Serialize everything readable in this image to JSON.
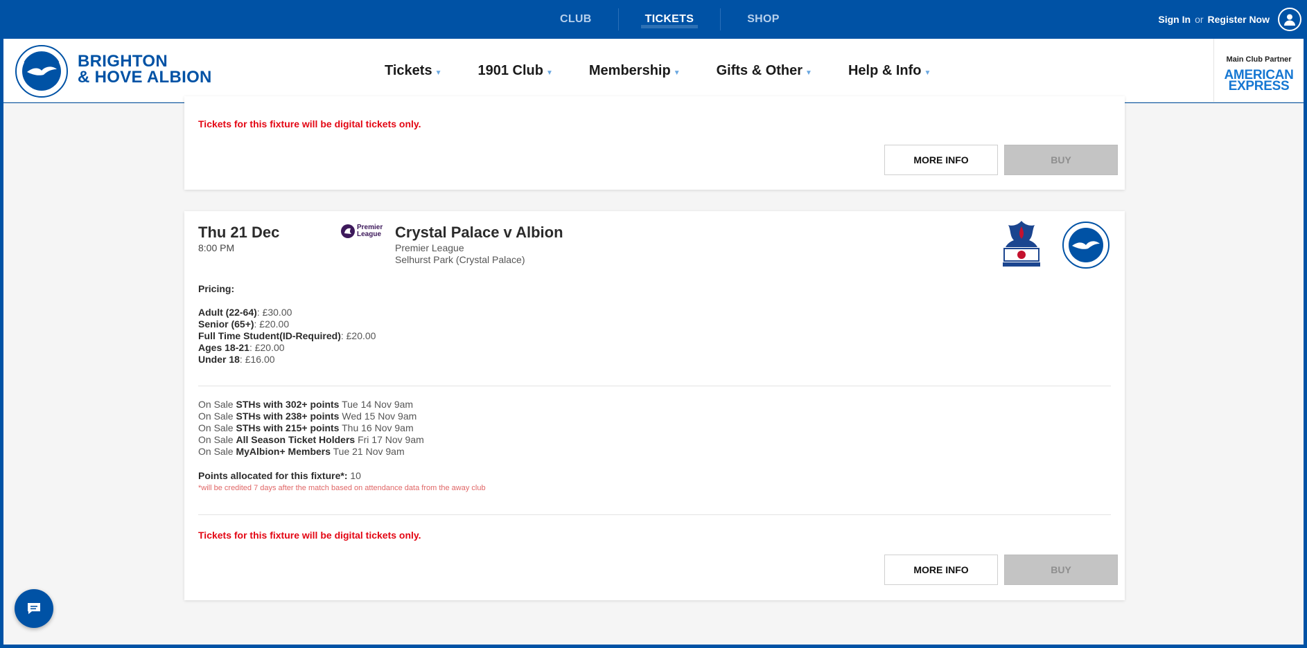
{
  "topnav": {
    "items": [
      {
        "label": "CLUB"
      },
      {
        "label": "TICKETS"
      },
      {
        "label": "SHOP"
      }
    ]
  },
  "account": {
    "sign_in": "Sign In",
    "or": "or",
    "register": "Register Now"
  },
  "header": {
    "club_name_line1": "BRIGHTON",
    "club_name_line2": "& HOVE ALBION",
    "nav": [
      {
        "label": "Tickets"
      },
      {
        "label": "1901 Club"
      },
      {
        "label": "Membership"
      },
      {
        "label": "Gifts & Other"
      },
      {
        "label": "Help & Info"
      }
    ],
    "partner_label": "Main Club Partner",
    "partner_line1": "AMERICAN",
    "partner_line2": "EXPRESS"
  },
  "card1": {
    "digital_notice": "Tickets for this fixture will be digital tickets only.",
    "more_info": "MORE INFO",
    "buy": "BUY"
  },
  "fixture": {
    "date": "Thu 21 Dec",
    "time": "8:00 PM",
    "competition_logo_line1": "Premier",
    "competition_logo_line2": "League",
    "title": "Crystal Palace v Albion",
    "competition": "Premier League",
    "venue": "Selhurst Park (Crystal Palace)",
    "pricing_heading": "Pricing:",
    "prices": [
      {
        "label": "Adult (22-64)",
        "value": ": £30.00"
      },
      {
        "label": "Senior (65+)",
        "value": ": £20.00"
      },
      {
        "label": "Full Time Student(ID-Required)",
        "value": ": £20.00"
      },
      {
        "label": "Ages 18-21",
        "value": ": £20.00"
      },
      {
        "label": "Under 18",
        "value": ": £16.00"
      }
    ],
    "onsale": [
      {
        "prefix": "On Sale ",
        "group": "STHs with 302+ points",
        "when": " Tue 14 Nov 9am"
      },
      {
        "prefix": "On Sale ",
        "group": "STHs with 238+ points",
        "when": " Wed 15 Nov 9am"
      },
      {
        "prefix": "On Sale ",
        "group": "STHs with 215+ points",
        "when": " Thu 16 Nov 9am"
      },
      {
        "prefix": "On Sale ",
        "group": "All Season Ticket Holders",
        "when": " Fri 17 Nov 9am"
      },
      {
        "prefix": "On Sale ",
        "group": "MyAlbion+ Members",
        "when": " Tue 21 Nov 9am"
      }
    ],
    "points_label": "Points allocated for this fixture*:",
    "points_value": " 10",
    "points_note": "*will be credited 7 days after the match based on attendance data from the away club",
    "digital_notice": "Tickets for this fixture will be digital tickets only.",
    "more_info": "MORE INFO",
    "buy": "BUY"
  },
  "colors": {
    "brand_blue": "#0052a5",
    "notice_red": "#e30613",
    "buy_disabled": "#c4c4c4"
  }
}
